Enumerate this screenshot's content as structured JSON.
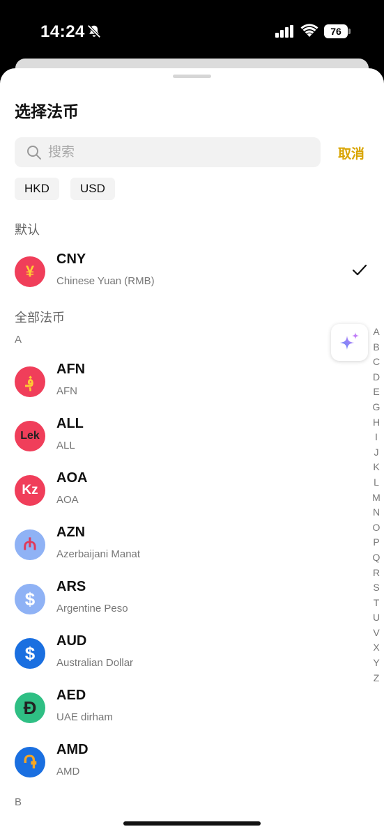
{
  "status_bar": {
    "time": "14:24",
    "battery": "76"
  },
  "header": {
    "title": "选择法币"
  },
  "search": {
    "placeholder": "搜索",
    "value": "",
    "cancel_label": "取消"
  },
  "chips": [
    "HKD",
    "USD"
  ],
  "default_section": {
    "label": "默认",
    "item": {
      "code": "CNY",
      "name": "Chinese Yuan (RMB)",
      "symbol": "¥",
      "color": "#f03e5a",
      "selected": true
    }
  },
  "all_section": {
    "label": "全部法币",
    "letter_a": "A",
    "items": [
      {
        "code": "AFN",
        "name": "AFN",
        "symbol": "؋",
        "color": "#f03e5a",
        "symbol_color": "#ffcc33"
      },
      {
        "code": "ALL",
        "name": "ALL",
        "symbol": "Lek",
        "color": "#f03e5a",
        "symbol_color": "#222222"
      },
      {
        "code": "AOA",
        "name": "AOA",
        "symbol": "Kz",
        "color": "#f03e5a",
        "symbol_color": "#ffffff"
      },
      {
        "code": "AZN",
        "name": "Azerbaijani Manat",
        "symbol": "₼",
        "color": "#8fb2f5",
        "symbol_color": "#e03a5a"
      },
      {
        "code": "ARS",
        "name": "Argentine Peso",
        "symbol": "$",
        "color": "#8fb2f5",
        "symbol_color": "#ffffff"
      },
      {
        "code": "AUD",
        "name": "Australian Dollar",
        "symbol": "$",
        "color": "#1a6fe0",
        "symbol_color": "#ffffff"
      },
      {
        "code": "AED",
        "name": "UAE dirham",
        "symbol": "Đ",
        "color": "#2fbf84",
        "symbol_color": "#222222"
      },
      {
        "code": "AMD",
        "name": "AMD",
        "symbol": "֏",
        "color": "#1a6fe0",
        "symbol_color": "#f5a623"
      }
    ],
    "letter_b": "B"
  },
  "index_letters": [
    "A",
    "B",
    "C",
    "D",
    "E",
    "G",
    "H",
    "I",
    "J",
    "K",
    "L",
    "M",
    "N",
    "O",
    "P",
    "Q",
    "R",
    "S",
    "T",
    "U",
    "V",
    "X",
    "Y",
    "Z"
  ],
  "colors": {
    "accent": "#d9a400",
    "ai_gradient_start": "#5b8cf7",
    "ai_gradient_end": "#c07cf7"
  }
}
